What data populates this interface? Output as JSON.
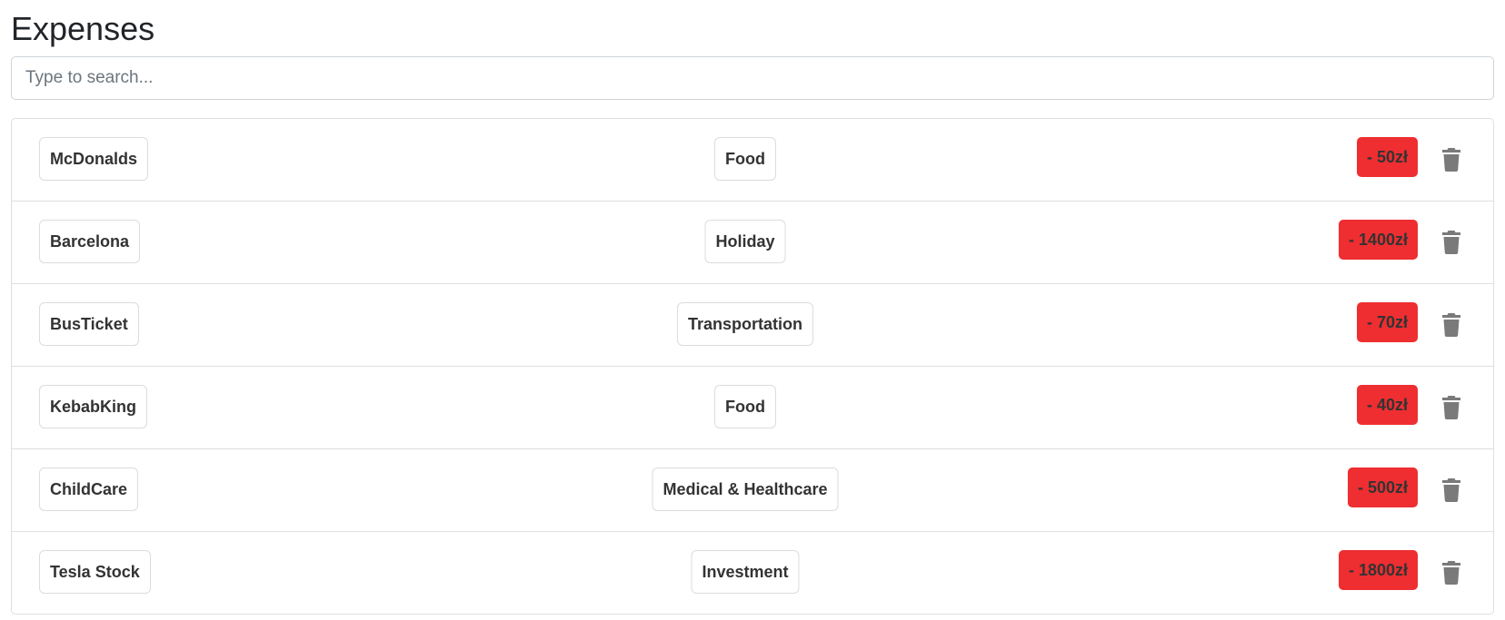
{
  "page": {
    "title": "Expenses"
  },
  "search": {
    "placeholder": "Type to search...",
    "value": ""
  },
  "colors": {
    "amount_badge": "#ee2e31",
    "trash_icon": "#7a7a7a",
    "border": "#dfdfdf"
  },
  "expenses": [
    {
      "name": "McDonalds",
      "category": "Food",
      "amount": "- 50zł",
      "icon": "trash-icon"
    },
    {
      "name": "Barcelona",
      "category": "Holiday",
      "amount": "- 1400zł",
      "icon": "trash-icon"
    },
    {
      "name": "BusTicket",
      "category": "Transportation",
      "amount": "- 70zł",
      "icon": "trash-icon"
    },
    {
      "name": "KebabKing",
      "category": "Food",
      "amount": "- 40zł",
      "icon": "trash-icon"
    },
    {
      "name": "ChildCare",
      "category": "Medical & Healthcare",
      "amount": "- 500zł",
      "icon": "trash-icon"
    },
    {
      "name": "Tesla Stock",
      "category": "Investment",
      "amount": "- 1800zł",
      "icon": "trash-icon"
    }
  ]
}
